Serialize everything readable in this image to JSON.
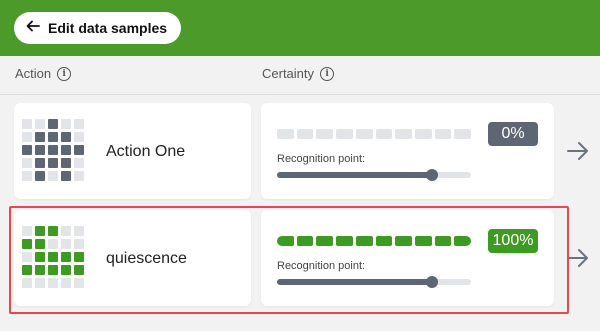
{
  "header": {
    "back_label": "Edit data samples",
    "back_icon": "arrow-left-icon",
    "color": "#4c9a2a"
  },
  "columns": {
    "action_label": "Action",
    "certainty_label": "Certainty",
    "info_icon": "i"
  },
  "rows": [
    {
      "name": "Action One",
      "certainty": "0%",
      "certainty_fraction": 0.0,
      "recognition_label": "Recognition point:",
      "recognition_point": 0.8,
      "color": "#5e6573",
      "pattern": [
        [
          0,
          0,
          1,
          0,
          0
        ],
        [
          0,
          1,
          1,
          1,
          0
        ],
        [
          1,
          1,
          1,
          1,
          1
        ],
        [
          0,
          1,
          1,
          1,
          0
        ],
        [
          0,
          1,
          0,
          1,
          0
        ]
      ]
    },
    {
      "name": "quiescence",
      "certainty": "100%",
      "certainty_fraction": 1.0,
      "recognition_label": "Recognition point:",
      "recognition_point": 0.8,
      "color": "#3e9a22",
      "pattern": [
        [
          0,
          1,
          1,
          0,
          0
        ],
        [
          1,
          1,
          0,
          0,
          0
        ],
        [
          0,
          1,
          1,
          1,
          1
        ],
        [
          1,
          1,
          1,
          1,
          1
        ],
        [
          0,
          0,
          0,
          0,
          0
        ]
      ]
    }
  ],
  "selected_row_index": 1,
  "row_arrow_icon": "arrow-right-icon"
}
